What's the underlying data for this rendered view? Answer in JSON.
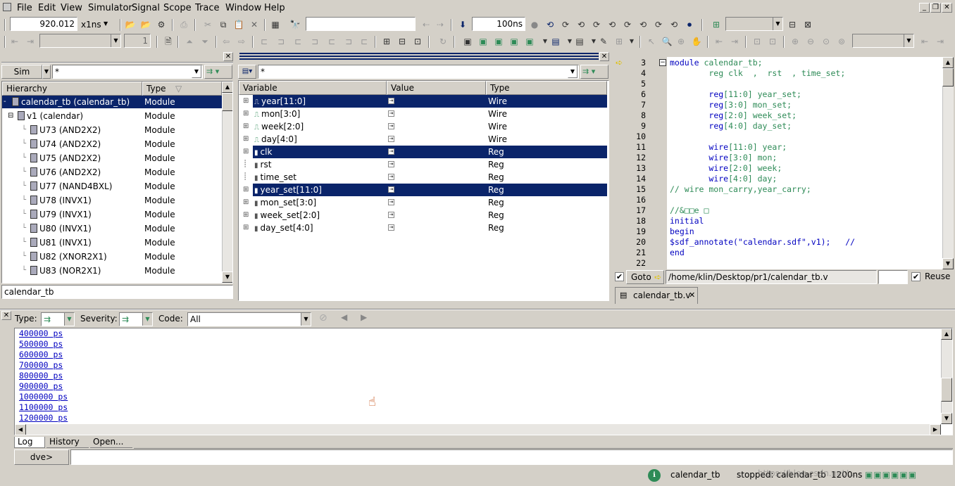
{
  "menu": [
    "File",
    "Edit",
    "View",
    "Simulator",
    "Signal",
    "Scope",
    "Trace",
    "Window",
    "Help"
  ],
  "toolbar": {
    "time_value": "920.012",
    "time_unit": "x1ns",
    "search_value": "",
    "step_value": "100ns",
    "page_value": "1"
  },
  "hierarchy": {
    "sim_tab": "Sim",
    "filter": "*",
    "col_hierarchy": "Hierarchy",
    "col_type": "Type",
    "rows": [
      {
        "name": "calendar_tb (calendar_tb)",
        "type": "Module"
      },
      {
        "name": "v1 (calendar)",
        "type": "Module"
      },
      {
        "name": "U73 (AND2X2)",
        "type": "Module"
      },
      {
        "name": "U74 (AND2X2)",
        "type": "Module"
      },
      {
        "name": "U75 (AND2X2)",
        "type": "Module"
      },
      {
        "name": "U76 (AND2X2)",
        "type": "Module"
      },
      {
        "name": "U77 (NAND4BXL)",
        "type": "Module"
      },
      {
        "name": "U78 (INVX1)",
        "type": "Module"
      },
      {
        "name": "U79 (INVX1)",
        "type": "Module"
      },
      {
        "name": "U80 (INVX1)",
        "type": "Module"
      },
      {
        "name": "U81 (INVX1)",
        "type": "Module"
      },
      {
        "name": "U82 (XNOR2X1)",
        "type": "Module"
      },
      {
        "name": "U83 (NOR2X1)",
        "type": "Module"
      }
    ],
    "scope": "calendar_tb"
  },
  "variables": {
    "filter": "*",
    "col_variable": "Variable",
    "col_value": "Value",
    "col_type": "Type",
    "rows": [
      {
        "name": "year[11:0]",
        "type": "Wire"
      },
      {
        "name": "mon[3:0]",
        "type": "Wire"
      },
      {
        "name": "week[2:0]",
        "type": "Wire"
      },
      {
        "name": "day[4:0]",
        "type": "Wire"
      },
      {
        "name": "clk",
        "type": "Reg"
      },
      {
        "name": "rst",
        "type": "Reg"
      },
      {
        "name": "time_set",
        "type": "Reg"
      },
      {
        "name": "year_set[11:0]",
        "type": "Reg"
      },
      {
        "name": "mon_set[3:0]",
        "type": "Reg"
      },
      {
        "name": "week_set[2:0]",
        "type": "Reg"
      },
      {
        "name": "day_set[4:0]",
        "type": "Reg"
      }
    ]
  },
  "source": {
    "line_numbers": [
      "3",
      "4",
      "5",
      "6",
      "7",
      "8",
      "9",
      "10",
      "11",
      "12",
      "13",
      "14",
      "15",
      "16",
      "17",
      "18",
      "19",
      "20",
      "21",
      "22"
    ],
    "lines": [
      {
        "a": "module ",
        "b": "calendar_tb;",
        "c": ""
      },
      {
        "a": "        reg clk  ,  rst  , time_set;",
        "b": "",
        "c": ""
      },
      {
        "a": "",
        "b": "",
        "c": ""
      },
      {
        "a": "        ",
        "b": "reg",
        "c": "[11:0] year_set;"
      },
      {
        "a": "        ",
        "b": "reg",
        "c": "[3:0] mon_set;"
      },
      {
        "a": "        ",
        "b": "reg",
        "c": "[2:0] week_set;"
      },
      {
        "a": "        ",
        "b": "reg",
        "c": "[4:0] day_set;"
      },
      {
        "a": "",
        "b": "",
        "c": ""
      },
      {
        "a": "        ",
        "b": "wire",
        "c": "[11:0] year;"
      },
      {
        "a": "        ",
        "b": "wire",
        "c": "[3:0] mon;"
      },
      {
        "a": "        ",
        "b": "wire",
        "c": "[2:0] week;"
      },
      {
        "a": "        ",
        "b": "wire",
        "c": "[4:0] day;"
      },
      {
        "a": "// wire mon_carry,year_carry;",
        "b": "",
        "c": ""
      },
      {
        "a": "",
        "b": "",
        "c": ""
      },
      {
        "a": "//&□□e □",
        "b": "",
        "c": ""
      },
      {
        "a": "initial",
        "b": "",
        "c": ""
      },
      {
        "a": "begin",
        "b": "",
        "c": ""
      },
      {
        "a": "$sdf_annotate(\"calendar.sdf\",v1);   //",
        "b": "",
        "c": ""
      },
      {
        "a": "end",
        "b": "",
        "c": ""
      },
      {
        "a": "",
        "b": "",
        "c": ""
      }
    ],
    "goto_label": "Goto",
    "path": "/home/klin/Desktop/pr1/calendar_tb.v",
    "reuse_label": "Reuse",
    "file_tab": "calendar_tb.v"
  },
  "console": {
    "type_label": "Type:",
    "severity_label": "Severity:",
    "code_label": "Code:",
    "code_value": "All",
    "log_lines": [
      "400000  ps",
      "500000  ps",
      "600000  ps",
      "700000  ps",
      "800000  ps",
      "900000  ps",
      "1000000  ps",
      "1100000  ps",
      "1200000  ps"
    ],
    "tabs": [
      "Log",
      "History",
      "Open..."
    ],
    "prompt": "dve>"
  },
  "status": {
    "scope": "calendar_tb",
    "state": "stopped: calendar_tb",
    "time": "1200ns",
    "watermark": "https://blog.csdn.net/..."
  }
}
